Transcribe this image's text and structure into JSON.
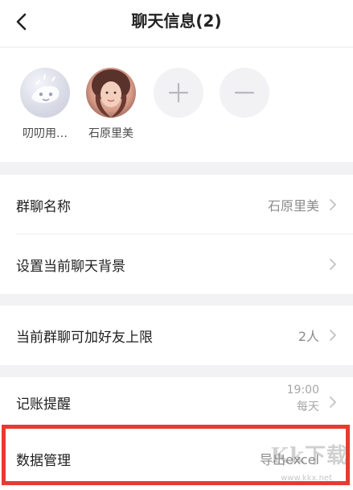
{
  "header": {
    "title": "聊天信息(2)"
  },
  "members": [
    {
      "name": "叨叨用…",
      "avatar": "ghost-avatar"
    },
    {
      "name": "石原里美",
      "avatar": "photo-avatar"
    }
  ],
  "member_actions": {
    "add_icon": "plus-icon",
    "remove_icon": "minus-icon"
  },
  "settings": {
    "group_name": {
      "label": "群聊名称",
      "value": "石原里美"
    },
    "chat_background": {
      "label": "设置当前聊天背景"
    },
    "friend_limit": {
      "label": "当前群聊可加好友上限",
      "value": "2人"
    },
    "reminder": {
      "label": "记账提醒",
      "time": "19:00",
      "frequency": "每天"
    },
    "data_management": {
      "label": "数据管理",
      "value": "导出excel"
    }
  },
  "watermark": {
    "text": "Kk下载",
    "sub": "www.kkx.net"
  },
  "colors": {
    "highlight": "#e63b2e",
    "background": "#f2f2f5"
  }
}
